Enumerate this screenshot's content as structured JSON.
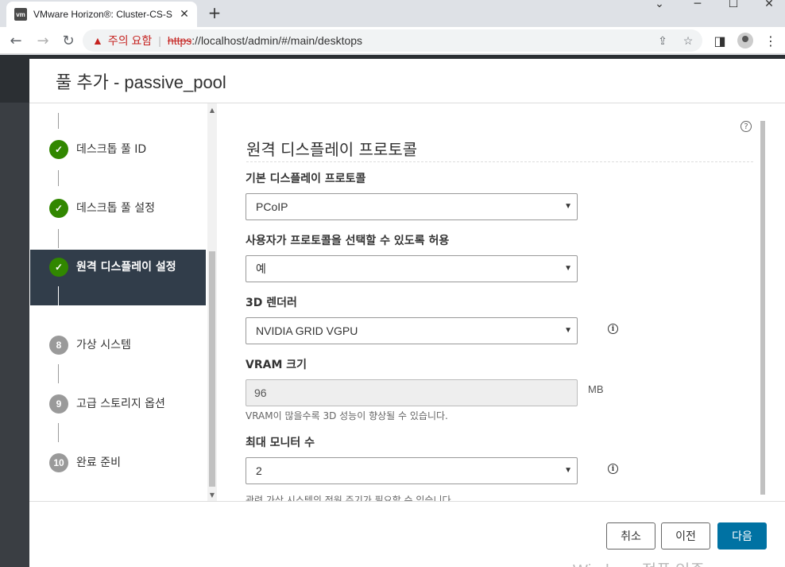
{
  "browser": {
    "tab_title": "VMware Horizon®: Cluster-CS-S",
    "favicon_text": "vm",
    "security_warning": "주의 요함",
    "url_scheme": "https",
    "url_rest": "://localhost/admin/#/main/desktops"
  },
  "modal": {
    "title": "풀 추가 - passive_pool"
  },
  "steps": [
    {
      "marker": "✓",
      "label": "데스크톱 풀 ID",
      "state": "done"
    },
    {
      "marker": "✓",
      "label": "데스크톱 풀 설정",
      "state": "done"
    },
    {
      "marker": "✓",
      "label": "원격 디스플레이 설정",
      "state": "active"
    },
    {
      "marker": "8",
      "label": "가상 시스템",
      "state": "pending"
    },
    {
      "marker": "9",
      "label": "고급 스토리지 옵션",
      "state": "pending"
    },
    {
      "marker": "10",
      "label": "완료 준비",
      "state": "pending"
    }
  ],
  "content": {
    "section_title": "원격 디스플레이 프로토콜",
    "fields": {
      "default_protocol": {
        "label": "기본 디스플레이 프로토콜",
        "value": "PCoIP"
      },
      "allow_choose": {
        "label": "사용자가 프로토콜을 선택할 수 있도록 허용",
        "value": "예"
      },
      "renderer_3d": {
        "label": "3D 렌더러",
        "value": "NVIDIA GRID VGPU"
      },
      "vram": {
        "label": "VRAM 크기",
        "value": "96",
        "unit": "MB",
        "helper": "VRAM이 많을수록 3D 성능이 향상될 수 있습니다."
      },
      "max_monitors": {
        "label": "최대 모니터 수",
        "value": "2",
        "helper": "관련 가상 시스템의 전원 주기가 필요할 수 있습니다."
      }
    }
  },
  "footer": {
    "cancel": "취소",
    "back": "이전",
    "next": "다음",
    "watermark": "Windows 정품 인증"
  }
}
